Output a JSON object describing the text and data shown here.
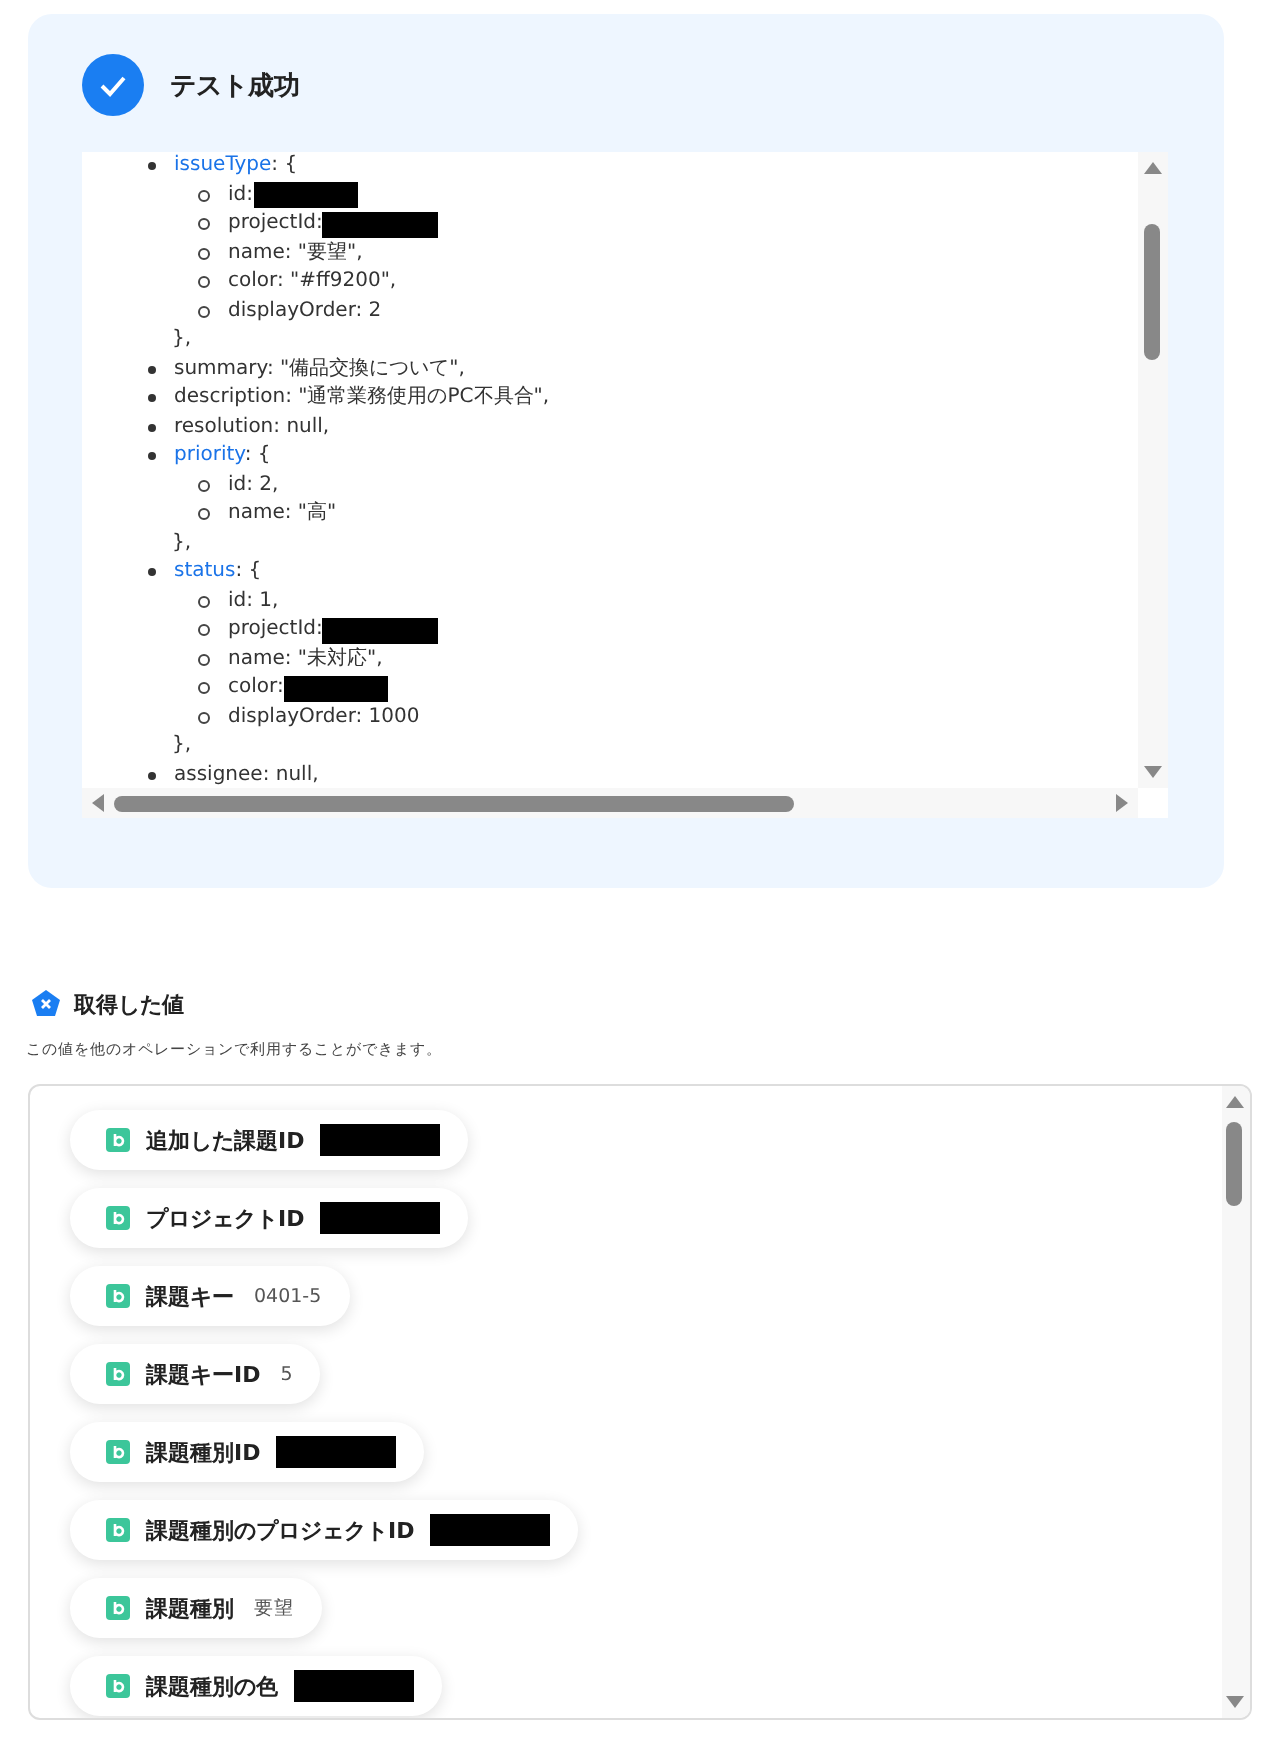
{
  "test_result": {
    "title": "テスト成功",
    "success": true,
    "code_lines": [
      {
        "kind": "object",
        "key": "issueType",
        "open": ": {",
        "close": "},",
        "children": [
          {
            "text": "id:",
            "redacted": true
          },
          {
            "text": "projectId:",
            "redacted": true
          },
          {
            "text": "name: \"要望\",",
            "redacted": false
          },
          {
            "text": "color: \"#ff9200\",",
            "redacted": false
          },
          {
            "text": "displayOrder: 2",
            "redacted": false
          }
        ]
      },
      {
        "kind": "field",
        "text": "summary: \"備品交換について\","
      },
      {
        "kind": "field",
        "text": "description: \"通常業務使用のPC不具合\","
      },
      {
        "kind": "field",
        "text": "resolution: null,"
      },
      {
        "kind": "object",
        "key": "priority",
        "open": ": {",
        "close": "},",
        "children": [
          {
            "text": "id: 2,",
            "redacted": false
          },
          {
            "text": "name: \"高\"",
            "redacted": false
          }
        ]
      },
      {
        "kind": "object",
        "key": "status",
        "open": ": {",
        "close": "},",
        "children": [
          {
            "text": "id: 1,",
            "redacted": false
          },
          {
            "text": "projectId:",
            "redacted": true
          },
          {
            "text": "name: \"未対応\",",
            "redacted": false
          },
          {
            "text": "color:",
            "redacted": true
          },
          {
            "text": "displayOrder: 1000",
            "redacted": false
          }
        ]
      },
      {
        "kind": "field",
        "text": "assignee: null,"
      }
    ]
  },
  "output_values": {
    "title": "取得した値",
    "description": "この値を他のオペレーションで利用することができます。",
    "items": [
      {
        "label": "追加した課題ID",
        "redacted": true
      },
      {
        "label": "プロジェクトID",
        "redacted": true
      },
      {
        "label": "課題キー",
        "value": "0401-5",
        "redacted": false
      },
      {
        "label": "課題キーID",
        "value": "5",
        "redacted": false
      },
      {
        "label": "課題種別ID",
        "redacted": true
      },
      {
        "label": "課題種別のプロジェクトID",
        "redacted": true
      },
      {
        "label": "課題種別",
        "value": "要望",
        "redacted": false
      },
      {
        "label": "課題種別の色",
        "redacted": true
      }
    ]
  }
}
